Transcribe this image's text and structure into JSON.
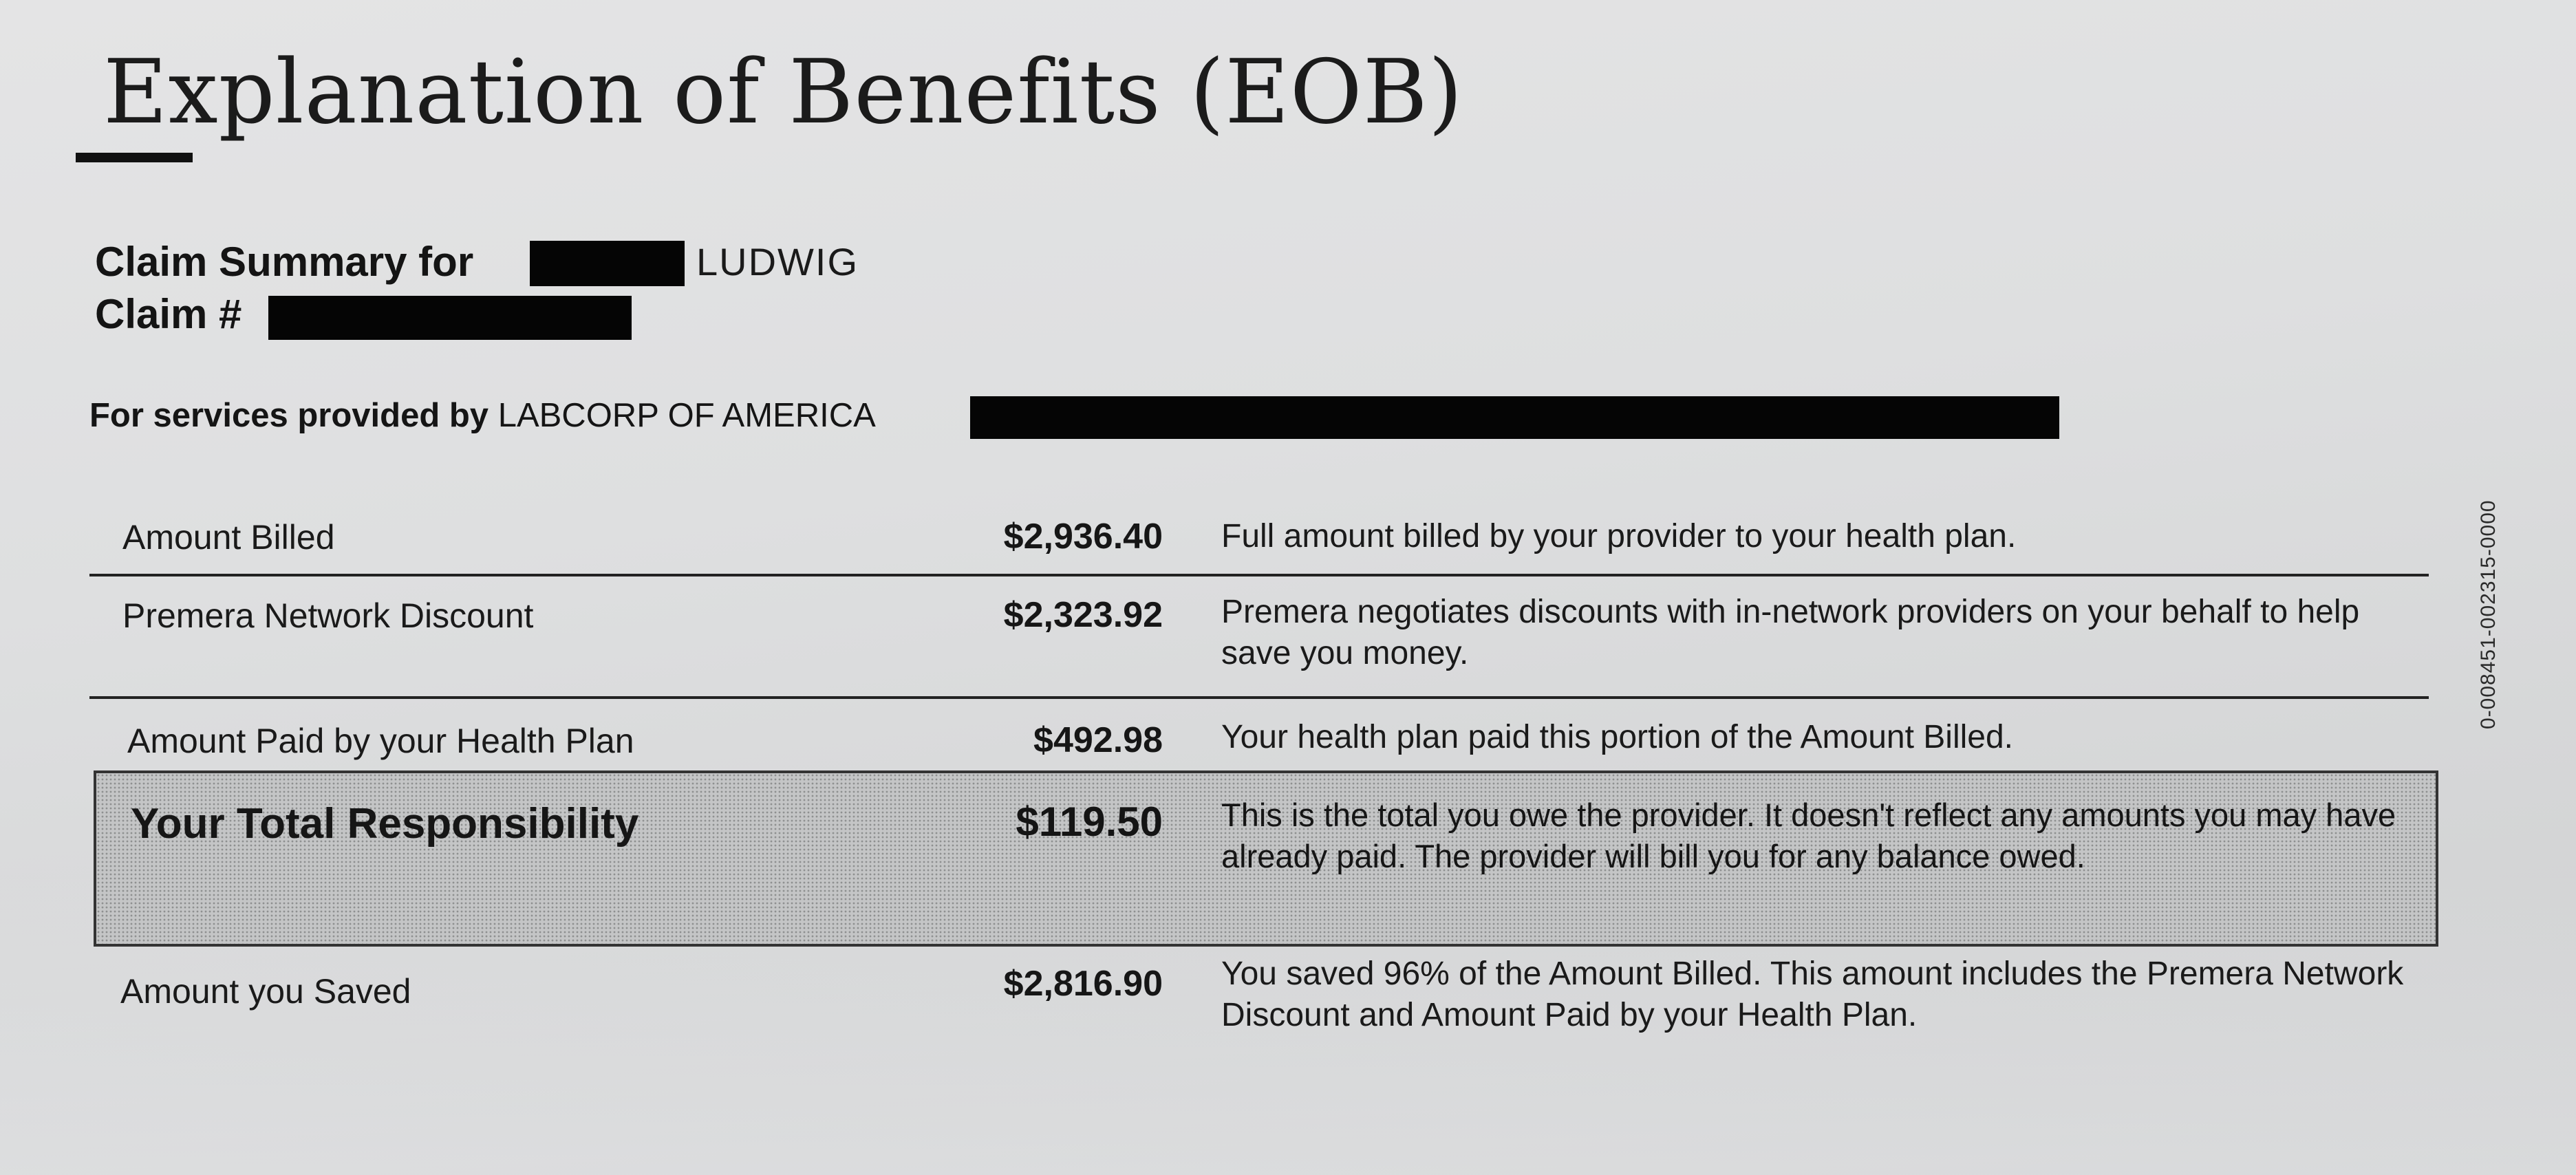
{
  "document": {
    "title": "Explanation of Benefits (EOB)",
    "claim_summary_label": "Claim Summary for",
    "claim_name_suffix": "LUDWIG",
    "claim_number_label": "Claim #",
    "services_label": "For services provided by",
    "provider_name": "LABCORP OF AMERICA",
    "side_code": "0-008451-002315-0000"
  },
  "rows": [
    {
      "label": "Amount Billed",
      "amount": "$2,936.40",
      "description": "Full amount billed by your provider to your health plan."
    },
    {
      "label": "Premera Network Discount",
      "amount": "$2,323.92",
      "description": "Premera negotiates discounts with in-network providers on your behalf to help save you money."
    },
    {
      "label": "Amount Paid by your Health Plan",
      "amount": "$492.98",
      "description": "Your health plan paid this portion of the Amount Billed."
    }
  ],
  "total": {
    "label": "Your Total Responsibility",
    "amount": "$119.50",
    "description": "This is the total you owe the provider. It doesn't reflect any amounts you may have already paid. The provider will bill you for any balance owed."
  },
  "saved": {
    "label": "Amount you Saved",
    "amount": "$2,816.90",
    "description": "You saved 96% of the Amount Billed. This amount includes the Premera Network Discount and Amount Paid by your Health Plan."
  }
}
